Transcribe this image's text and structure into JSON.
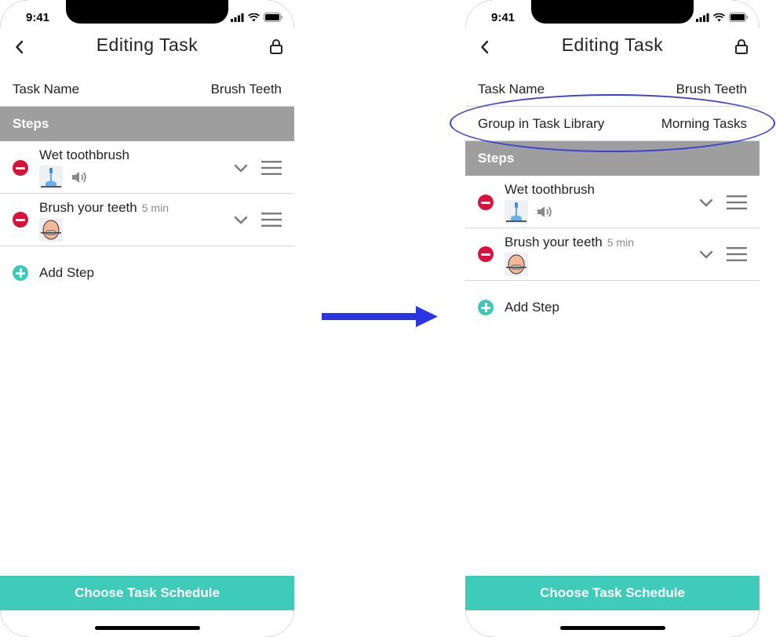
{
  "colors": {
    "accent": "#3ecbb9",
    "remove": "#d7133b",
    "section_header": "#9e9e9e",
    "annotation": "#3a3fd6"
  },
  "left_screen": {
    "status": {
      "time": "9:41",
      "icons": [
        "signal-icon",
        "wifi-icon",
        "battery-icon"
      ]
    },
    "nav": {
      "back_icon": "chevron-left-icon",
      "title": "Editing Task",
      "lock_icon": "lock-icon"
    },
    "task_name": {
      "label": "Task Name",
      "value": "Brush Teeth"
    },
    "steps_header": "Steps",
    "steps": [
      {
        "title": "Wet toothbrush",
        "duration": "",
        "has_audio": true,
        "thumb": "toothbrush-icon"
      },
      {
        "title": "Brush your teeth",
        "duration": "5 min",
        "has_audio": false,
        "thumb": "brushing-teeth-icon"
      }
    ],
    "add_step": "Add Step",
    "bottom_button": "Choose Task Schedule"
  },
  "right_screen": {
    "status": {
      "time": "9:41",
      "icons": [
        "signal-icon",
        "wifi-icon",
        "battery-icon"
      ]
    },
    "nav": {
      "back_icon": "chevron-left-icon",
      "title": "Editing Task",
      "lock_icon": "lock-icon"
    },
    "task_name": {
      "label": "Task Name",
      "value": "Brush Teeth"
    },
    "group": {
      "label": "Group in Task Library",
      "value": "Morning Tasks"
    },
    "steps_header": "Steps",
    "steps": [
      {
        "title": "Wet toothbrush",
        "duration": "",
        "has_audio": true,
        "thumb": "toothbrush-icon"
      },
      {
        "title": "Brush your teeth",
        "duration": "5 min",
        "has_audio": false,
        "thumb": "brushing-teeth-icon"
      }
    ],
    "add_step": "Add Step",
    "bottom_button": "Choose Task Schedule"
  },
  "annotation": {
    "arrow_icon": "right-arrow-icon",
    "highlight": "oval-highlight"
  }
}
